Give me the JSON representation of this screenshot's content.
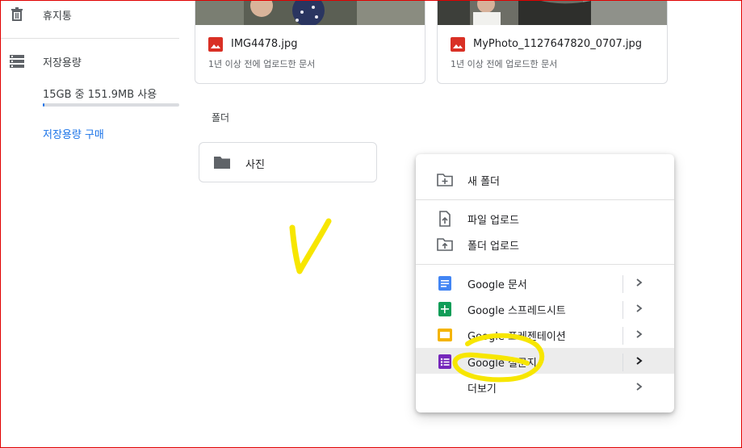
{
  "sidebar": {
    "trash_label": "휴지통",
    "storage_label": "저장용량",
    "storage_usage": "15GB 중 151.9MB 사용",
    "storage_fraction": 0.01,
    "buy_storage_label": "저장용량 구매"
  },
  "files": [
    {
      "name": "IMG4478.jpg",
      "subtitle": "1년 이상 전에 업로드한 문서"
    },
    {
      "name": "MyPhoto_1127647820_0707.jpg",
      "subtitle": "1년 이상 전에 업로드한 문서"
    }
  ],
  "folders_section_label": "폴더",
  "folders": [
    {
      "name": "사진"
    }
  ],
  "menu": {
    "new_folder": "새 폴더",
    "file_upload": "파일 업로드",
    "folder_upload": "폴더 업로드",
    "docs": "Google 문서",
    "sheets": "Google 스프레드시트",
    "slides": "Google 프레젠테이션",
    "forms": "Google 설문지",
    "more": "더보기"
  },
  "colors": {
    "accent": "#1a73e8",
    "docs": "#4285f4",
    "sheets": "#0f9d58",
    "slides": "#f4b400",
    "forms": "#7627bb",
    "image_icon": "#d93025",
    "annotation": "#f7e600"
  }
}
